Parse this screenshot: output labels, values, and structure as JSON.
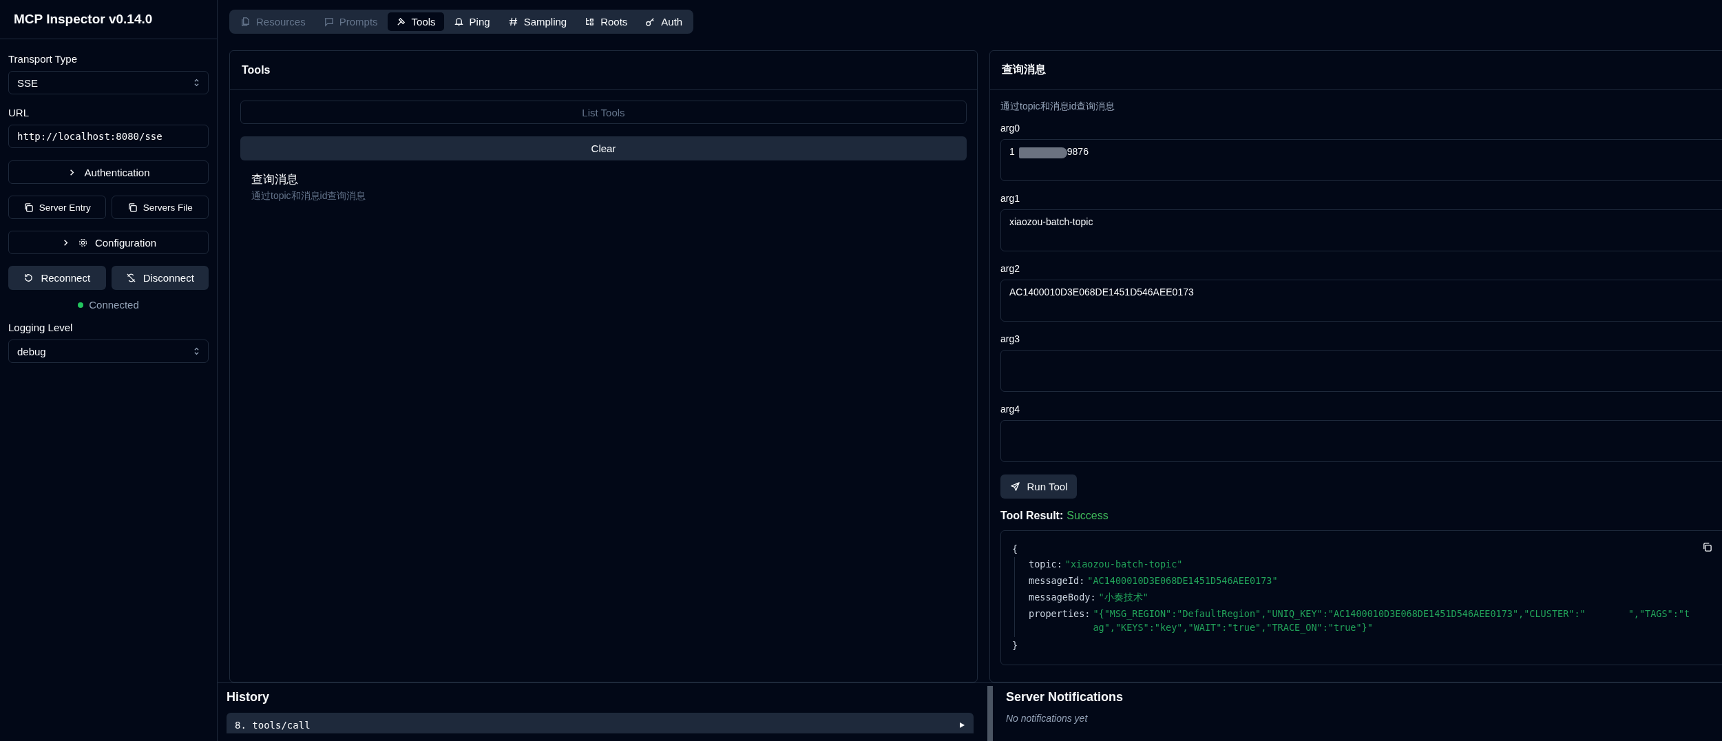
{
  "sidebar": {
    "title": "MCP Inspector v0.14.0",
    "transport_label": "Transport Type",
    "transport_value": "SSE",
    "url_label": "URL",
    "url_value": "http://localhost:8080/sse",
    "auth_button": "Authentication",
    "server_entry_button": "Server Entry",
    "servers_file_button": "Servers File",
    "config_button": "Configuration",
    "reconnect_button": "Reconnect",
    "disconnect_button": "Disconnect",
    "status_text": "Connected",
    "logging_label": "Logging Level",
    "logging_value": "debug"
  },
  "tabs": [
    {
      "label": "Resources",
      "selected": false,
      "disabled": true
    },
    {
      "label": "Prompts",
      "selected": false,
      "disabled": true
    },
    {
      "label": "Tools",
      "selected": true,
      "disabled": false
    },
    {
      "label": "Ping",
      "selected": false,
      "disabled": false
    },
    {
      "label": "Sampling",
      "selected": false,
      "disabled": false
    },
    {
      "label": "Roots",
      "selected": false,
      "disabled": false
    },
    {
      "label": "Auth",
      "selected": false,
      "disabled": false
    }
  ],
  "tools_panel": {
    "title": "Tools",
    "list_button": {
      "label": "List Tools",
      "disabled": true
    },
    "clear_button": "Clear",
    "tools": [
      {
        "name": "查询消息",
        "description": "通过topic和消息id查询消息"
      }
    ]
  },
  "tool_panel": {
    "title": "查询消息",
    "description": "通过topic和消息id查询消息",
    "args": [
      {
        "label": "arg0",
        "value_parts": [
          "1",
          "9876"
        ]
      },
      {
        "label": "arg1",
        "value_parts": [
          "xiaozou-batch-topic"
        ]
      },
      {
        "label": "arg2",
        "value_parts": [
          "AC1400010D3E068DE1451D546AEE0173"
        ]
      },
      {
        "label": "arg3"
      },
      {
        "label": "arg4"
      }
    ],
    "run_button": "Run Tool",
    "result_label": "Tool Result:",
    "result_status": "Success",
    "result_open": "{",
    "result_close": "}",
    "result_entries": [
      {
        "key": "topic:",
        "value_parts": [
          "\"xiaozou-batch-topic\""
        ]
      },
      {
        "key": "messageId:",
        "value_parts": [
          "\"AC1400010D3E068DE1451D546AEE0173\""
        ]
      },
      {
        "key": "messageBody:",
        "value_parts": [
          "\"小奏技术\""
        ]
      },
      {
        "key": "properties:",
        "value_parts": [
          "\"{\"MSG_REGION\":\"DefaultRegion\",\"UNIQ_KEY\":\"AC1400010D3E068DE1451D546AEE0173\",\"CLUSTER\":\"",
          "\",\"TAGS\":\"tag\",\"KEYS\":\"key\",\"WAIT\":\"true\",\"TRACE_ON\":\"true\"}\""
        ]
      }
    ]
  },
  "history": {
    "title": "History",
    "entries": [
      {
        "label": "8. tools/call",
        "expanded": false
      }
    ]
  },
  "notifications": {
    "title": "Server Notifications",
    "empty_text": "No notifications yet"
  }
}
